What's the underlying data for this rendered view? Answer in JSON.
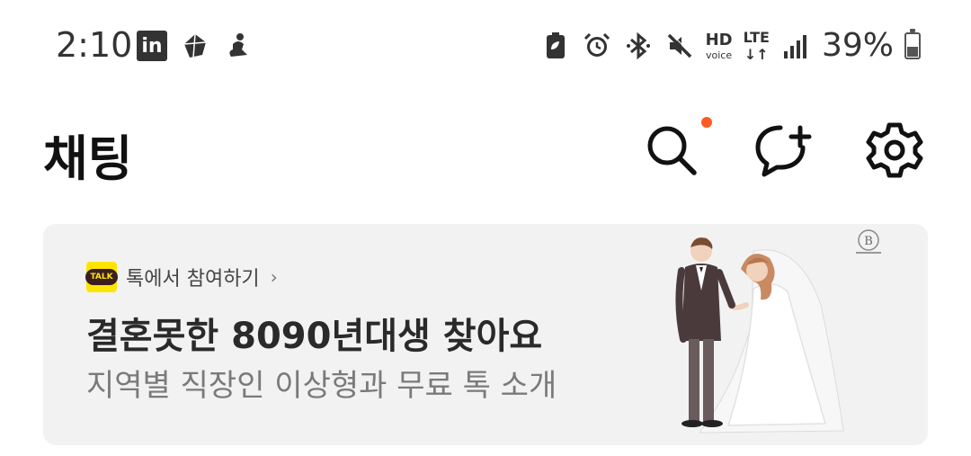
{
  "status_bar": {
    "time": "2:10",
    "left_icons": [
      "linkedin-icon",
      "game-app-icon",
      "ride-app-icon"
    ],
    "right_icons": [
      "battery-saver-icon",
      "alarm-icon",
      "bluetooth-icon",
      "mute-icon",
      "hd-voice-icon",
      "lte-icon",
      "signal-icon"
    ],
    "hd_label": "HD",
    "voice_label": "voice",
    "lte_label": "LTE",
    "lte_arrows": "↓↑",
    "battery_percent": "39%",
    "battery_level": 0.39,
    "linkedin_label": "in"
  },
  "header": {
    "title": "채팅",
    "actions": [
      {
        "name": "search-icon",
        "has_notification": true
      },
      {
        "name": "new-chat-icon"
      },
      {
        "name": "settings-icon"
      }
    ],
    "notification_color": "#ff5a1f"
  },
  "banner": {
    "source_logo_text": "TALK",
    "source_label": "톡에서 참여하기",
    "source_chevron": "›",
    "headline": "결혼못한 8090년대생 찾아요",
    "subtext": "지역별 직장인 이상형과 무료 톡 소개",
    "seal_letter": "B",
    "background": "#f2f2f2"
  },
  "colors": {
    "kakao_yellow": "#fee500",
    "kakao_brown": "#3c1e1e",
    "accent_dot": "#ff5a1f"
  }
}
